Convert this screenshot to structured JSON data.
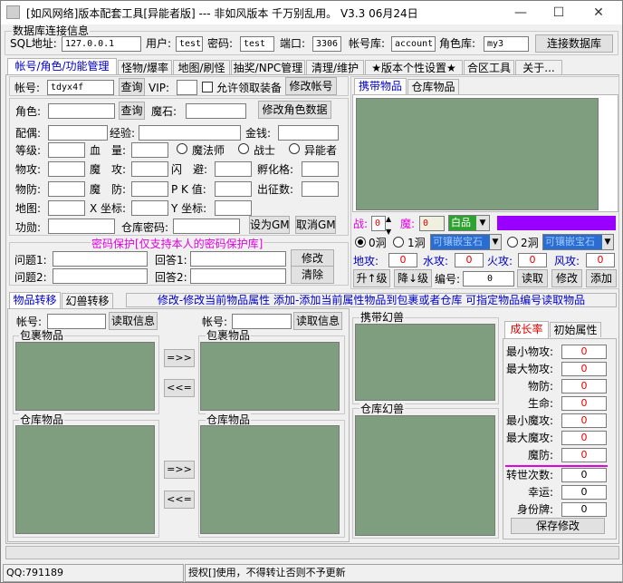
{
  "window": {
    "title": "[如风网络]版本配套工具[异能者版] --- 非如风版本 千万别乱用。 V3.3 06月24日"
  },
  "db": {
    "group": "数据库连接信息",
    "sql_label": "SQL地址:",
    "sql_value": "127.0.0.1",
    "user_label": "用户:",
    "user_value": "test",
    "pwd_label": "密码:",
    "pwd_value": "test",
    "port_label": "端口:",
    "port_value": "3306",
    "acct_db_label": "帐号库:",
    "acct_db_value": "account",
    "role_db_label": "角色库:",
    "role_db_value": "my3",
    "connect_btn": "连接数据库"
  },
  "tabs": [
    "帐号/角色/功能管理",
    "怪物/爆率",
    "地图/刷怪",
    "抽奖/NPC管理",
    "清理/维护",
    "★版本个性设置★",
    "合区工具",
    "关于..."
  ],
  "account": {
    "label": "帐号:",
    "value": "tdyx4f",
    "query_btn": "查询",
    "vip_label": "VIP:",
    "allow_label": "允许领取装备",
    "modify_btn": "修改帐号"
  },
  "role": {
    "role_label": "角色:",
    "query_btn": "查询",
    "magic_stone": "魔石:",
    "modify_btn": "修改角色数据",
    "spouse": "配偶:",
    "exp": "经验:",
    "gold": "金钱:",
    "level": "等级:",
    "blood": "血　量:",
    "mage": "魔法师",
    "warrior": "战士",
    "esper": "异能者",
    "phys_atk": "物攻:",
    "magic_atk": "魔　攻:",
    "dodge": "闪　避:",
    "incubate": "孵化格:",
    "phys_def": "物防:",
    "magic_def": "魔　防:",
    "pk": "P K 值:",
    "expedition": "出征数:",
    "map": "地图:",
    "xcoord": "X 坐标:",
    "ycoord": "Y 坐标:",
    "merit": "功勋:",
    "warehouse_pwd": "仓库密码:",
    "set_gm": "设为GM",
    "cancel_gm": "取消GM"
  },
  "pwd_protect": {
    "title": "密码保护[仅支持本人的密码保护库]",
    "q1": "问题1:",
    "a1": "回答1:",
    "q2": "问题2:",
    "a2": "回答2:",
    "modify_btn": "修改",
    "clear_btn": "清除"
  },
  "items_right": {
    "tab_carry": "携带物品",
    "tab_store": "仓库物品",
    "battle": "战:",
    "battle_val": "0",
    "magic": "魔:",
    "magic_val": "0",
    "grade": "白品",
    "hole0": "0洞",
    "hole1": "1洞",
    "hole2": "2洞",
    "gem_slot": "可镶嵌宝石",
    "gem_slot2": "可镶嵌宝石",
    "earth": "地攻:",
    "earth_val": "0",
    "water": "水攻:",
    "water_val": "0",
    "fire": "火攻:",
    "fire_val": "0",
    "wind": "风攻:",
    "wind_val": "0",
    "up_level": "升↑级",
    "down_level": "降↓级",
    "code": "编号:",
    "code_val": "0",
    "read_btn": "读取",
    "modify_btn": "修改",
    "add_btn": "添加"
  },
  "transfer": {
    "tab_items": "物品转移",
    "tab_pets": "幻兽转移",
    "hint": "修改-修改当前物品属性 添加-添加当前属性物品到包裹或者仓库 可指定物品编号读取物品",
    "acct1": "帐号:",
    "read1": "读取信息",
    "acct2": "帐号:",
    "read2": "读取信息",
    "bag1": "包裹物品",
    "bag2": "包裹物品",
    "store1": "仓库物品",
    "store2": "仓库物品",
    "right_arrow": "=>>",
    "left_arrow": "<<=",
    "right_arrow2": "=>>",
    "left_arrow2": "<<="
  },
  "pets": {
    "carry": "携带幻兽",
    "store": "仓库幻兽"
  },
  "growth": {
    "tab_growth": "成长率",
    "tab_init": "初始属性",
    "rows": [
      {
        "label": "最小物攻:",
        "value": "0"
      },
      {
        "label": "最大物攻:",
        "value": "0"
      },
      {
        "label": "物防:",
        "value": "0"
      },
      {
        "label": "生命:",
        "value": "0"
      },
      {
        "label": "最小魔攻:",
        "value": "0"
      },
      {
        "label": "最大魔攻:",
        "value": "0"
      },
      {
        "label": "魔防:",
        "value": "0"
      }
    ],
    "rows2": [
      {
        "label": "转世次数:",
        "value": "0"
      },
      {
        "label": "幸运:",
        "value": "0"
      },
      {
        "label": "身份牌:",
        "value": "0"
      }
    ],
    "save_btn": "保存修改"
  },
  "statusbar": {
    "qq": "QQ:791189",
    "license": "授权[]使用，不得转让否则不予更新"
  },
  "colors": {
    "list_bg": "#7f9d7f",
    "purple": "#9900ff",
    "grade_bg": "#2ea22e",
    "gem_bg": "#2a6cd0"
  }
}
